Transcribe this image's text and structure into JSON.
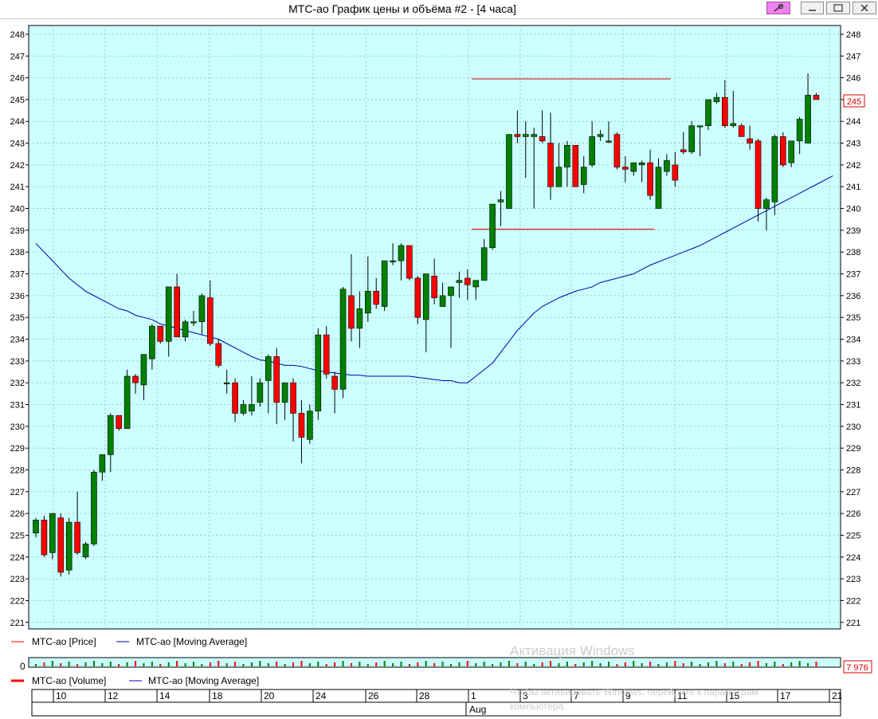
{
  "window": {
    "title": "МТС-ао График цены и объёма #2 - [4 часа]",
    "buttons": {
      "pin": "pin-icon",
      "minimize": "minimize-icon",
      "maximize": "maximize-icon",
      "close": "close-icon"
    }
  },
  "colors": {
    "chart_background": "#ccffff",
    "grid": "#9ab5b5",
    "bull": "#008000",
    "bear": "#ff0000",
    "moving_average": "#0000aa",
    "level_line": "#dd0000"
  },
  "price_panel": {
    "y_ticks": [
      248,
      247,
      246,
      245,
      244,
      243,
      242,
      241,
      240,
      239,
      238,
      237,
      236,
      235,
      234,
      233,
      232,
      231,
      230,
      229,
      228,
      227,
      226,
      225,
      224,
      223,
      222,
      221
    ],
    "current_price_label": "245",
    "legend": {
      "price": "МТС-ао [Price]",
      "moving_average": "МТС-ао [Moving Average]"
    }
  },
  "volume_panel": {
    "zero_label": "0",
    "current_volume_label": "7 976",
    "legend": {
      "volume": "МТС-ао [Volume]",
      "moving_average": "МТС-ао [Moving Average]"
    }
  },
  "time_axis": {
    "day_labels": [
      "10",
      "12",
      "14",
      "18",
      "20",
      "24",
      "26",
      "28",
      "1",
      "3",
      "7",
      "9",
      "11",
      "15",
      "17",
      "21"
    ],
    "month_label": "Aug"
  },
  "watermark": {
    "line1": "Активация Windows",
    "line2": "Чтобы активировать Windows, перейдите к параметрам",
    "line3": "компьютера."
  },
  "chart_data": {
    "type": "candlestick",
    "ylim": [
      220.7,
      248.4
    ],
    "levels": [
      {
        "price": 245.95,
        "from_bar": 53,
        "to_bar": 76
      },
      {
        "price": 239.05,
        "from_bar": 53,
        "to_bar": 74
      }
    ],
    "ohlc": [
      [
        225.1,
        225.8,
        224.9,
        225.7
      ],
      [
        225.7,
        225.9,
        224.0,
        224.1
      ],
      [
        224.2,
        226.0,
        223.9,
        226.0
      ],
      [
        225.8,
        226.0,
        223.1,
        223.3
      ],
      [
        223.4,
        225.8,
        223.2,
        225.6
      ],
      [
        225.6,
        227.0,
        224.1,
        224.2
      ],
      [
        224.0,
        224.7,
        223.9,
        224.6
      ],
      [
        224.6,
        228.0,
        224.5,
        227.9
      ],
      [
        227.9,
        228.7,
        227.5,
        228.7
      ],
      [
        228.7,
        230.6,
        227.9,
        230.5
      ],
      [
        230.5,
        230.5,
        229.8,
        229.9
      ],
      [
        229.9,
        232.6,
        229.9,
        232.3
      ],
      [
        232.3,
        232.4,
        231.5,
        232.0
      ],
      [
        231.9,
        233.3,
        231.2,
        233.3
      ],
      [
        233.1,
        234.7,
        232.6,
        234.6
      ],
      [
        234.6,
        234.6,
        233.8,
        233.9
      ],
      [
        233.9,
        236.4,
        233.2,
        236.4
      ],
      [
        236.4,
        237.0,
        234.1,
        234.1
      ],
      [
        234.1,
        234.9,
        233.9,
        234.8
      ],
      [
        234.8,
        235.3,
        234.6,
        234.8
      ],
      [
        234.8,
        236.1,
        234.2,
        236.0
      ],
      [
        235.9,
        236.7,
        233.7,
        233.8
      ],
      [
        233.8,
        234.0,
        232.7,
        232.8
      ],
      [
        232.0,
        232.6,
        231.5,
        232.0
      ],
      [
        232.0,
        232.2,
        230.2,
        230.6
      ],
      [
        230.6,
        231.2,
        230.5,
        231.0
      ],
      [
        230.7,
        232.3,
        230.5,
        231.0
      ],
      [
        231.1,
        232.2,
        230.9,
        232.0
      ],
      [
        232.1,
        233.3,
        230.6,
        233.2
      ],
      [
        233.2,
        233.6,
        230.1,
        231.1
      ],
      [
        231.1,
        232.0,
        230.3,
        232.0
      ],
      [
        232.0,
        232.2,
        229.3,
        230.6
      ],
      [
        230.6,
        231.2,
        228.3,
        229.5
      ],
      [
        229.4,
        231.0,
        229.2,
        230.7
      ],
      [
        230.7,
        234.5,
        230.3,
        234.2
      ],
      [
        234.2,
        234.6,
        232.2,
        232.4
      ],
      [
        232.3,
        232.5,
        230.6,
        231.7
      ],
      [
        231.7,
        236.4,
        231.3,
        236.3
      ],
      [
        236.0,
        237.9,
        233.9,
        234.5
      ],
      [
        234.5,
        236.2,
        233.6,
        235.4
      ],
      [
        235.2,
        237.8,
        234.8,
        236.2
      ],
      [
        236.2,
        236.8,
        235.4,
        235.6
      ],
      [
        235.5,
        237.6,
        235.3,
        237.6
      ],
      [
        237.6,
        238.4,
        237.4,
        237.6
      ],
      [
        237.6,
        238.4,
        236.7,
        238.3
      ],
      [
        238.3,
        238.3,
        236.7,
        236.8
      ],
      [
        236.8,
        236.9,
        234.7,
        235.0
      ],
      [
        234.9,
        237.0,
        233.4,
        237.0
      ],
      [
        236.9,
        237.7,
        235.6,
        235.9
      ],
      [
        235.5,
        236.6,
        235.5,
        236.0
      ],
      [
        236.0,
        236.2,
        233.6,
        236.4
      ],
      [
        236.6,
        237.1,
        235.9,
        236.7
      ],
      [
        236.8,
        237.2,
        235.8,
        236.5
      ],
      [
        236.4,
        236.5,
        235.8,
        236.7
      ],
      [
        236.7,
        238.6,
        236.7,
        238.2
      ],
      [
        238.2,
        240.2,
        238.1,
        240.2
      ],
      [
        240.3,
        240.8,
        239.2,
        240.4
      ],
      [
        240.0,
        243.4,
        240.0,
        243.4
      ],
      [
        243.4,
        244.5,
        243.0,
        243.3
      ],
      [
        243.3,
        244.0,
        241.4,
        243.4
      ],
      [
        243.3,
        243.7,
        240.0,
        243.4
      ],
      [
        243.3,
        244.5,
        243.0,
        243.1
      ],
      [
        243.0,
        244.4,
        240.4,
        241.0
      ],
      [
        241.0,
        243.0,
        241.0,
        241.9
      ],
      [
        241.9,
        243.1,
        241.0,
        242.9
      ],
      [
        242.9,
        242.9,
        241.0,
        241.0
      ],
      [
        241.1,
        242.4,
        240.7,
        241.9
      ],
      [
        242.0,
        244.0,
        241.9,
        243.3
      ],
      [
        243.3,
        243.6,
        243.1,
        243.4
      ],
      [
        243.1,
        244.0,
        243.0,
        243.1
      ],
      [
        243.4,
        243.5,
        241.8,
        241.9
      ],
      [
        241.9,
        242.4,
        241.2,
        241.8
      ],
      [
        241.7,
        242.0,
        241.5,
        242.1
      ],
      [
        242.0,
        242.2,
        241.2,
        242.1
      ],
      [
        242.1,
        242.7,
        240.4,
        240.6
      ],
      [
        240.0,
        242.3,
        240.0,
        241.9
      ],
      [
        241.7,
        242.5,
        241.5,
        242.2
      ],
      [
        242.0,
        242.6,
        241.0,
        241.3
      ],
      [
        242.7,
        243.5,
        242.5,
        242.6
      ],
      [
        242.6,
        244.0,
        242.5,
        243.8
      ],
      [
        243.8,
        243.8,
        242.4,
        243.8
      ],
      [
        243.8,
        245.0,
        243.6,
        245.0
      ],
      [
        244.9,
        245.3,
        244.8,
        245.1
      ],
      [
        245.1,
        245.9,
        243.7,
        243.8
      ],
      [
        243.8,
        245.4,
        243.7,
        243.9
      ],
      [
        243.8,
        243.9,
        243.3,
        243.3
      ],
      [
        243.2,
        243.8,
        242.7,
        243.0
      ],
      [
        243.1,
        243.2,
        239.4,
        240.0
      ],
      [
        240.0,
        240.5,
        239.0,
        240.4
      ],
      [
        240.3,
        243.4,
        239.7,
        243.3
      ],
      [
        243.3,
        243.5,
        241.9,
        242.0
      ],
      [
        242.1,
        243.1,
        241.9,
        243.1
      ],
      [
        243.1,
        244.2,
        242.5,
        244.1
      ],
      [
        243.0,
        246.2,
        243.0,
        245.2
      ],
      [
        245.2,
        245.3,
        245.0,
        245.0
      ]
    ],
    "moving_average": [
      238.4,
      238.0,
      237.6,
      237.2,
      236.8,
      236.5,
      236.2,
      236.0,
      235.8,
      235.6,
      235.4,
      235.3,
      235.1,
      235.0,
      234.9,
      234.7,
      234.6,
      234.5,
      234.4,
      234.3,
      234.2,
      234.1,
      234.0,
      233.8,
      233.6,
      233.4,
      233.2,
      233.05,
      233.0,
      232.9,
      232.8,
      232.8,
      232.75,
      232.65,
      232.55,
      232.5,
      232.45,
      232.4,
      232.35,
      232.35,
      232.3,
      232.3,
      232.3,
      232.3,
      232.3,
      232.3,
      232.25,
      232.2,
      232.15,
      232.1,
      232.1,
      232.0,
      232.0,
      232.3,
      232.6,
      232.9,
      233.4,
      233.9,
      234.4,
      234.8,
      235.2,
      235.5,
      235.7,
      235.9,
      236.05,
      236.2,
      236.3,
      236.4,
      236.6,
      236.7,
      236.8,
      236.9,
      237.0,
      237.2,
      237.4,
      237.55,
      237.7,
      237.85,
      238.0,
      238.15,
      238.3,
      238.5,
      238.7,
      238.9,
      239.1,
      239.3,
      239.5,
      239.7,
      239.9,
      240.1,
      240.3,
      240.5,
      240.7,
      240.9,
      241.1,
      241.3,
      241.5
    ]
  }
}
